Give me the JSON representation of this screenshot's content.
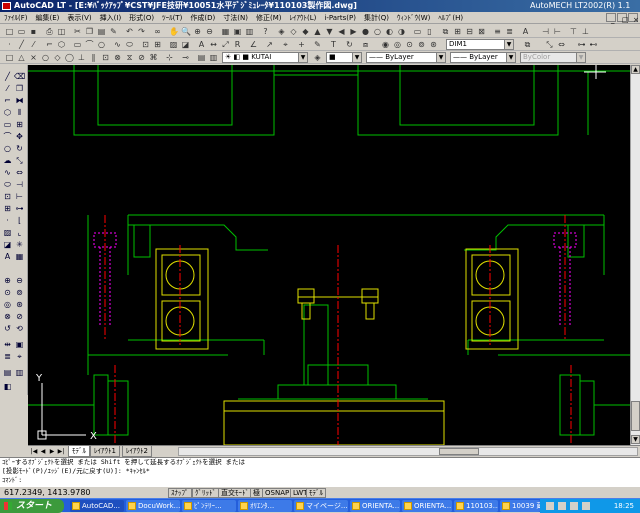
{
  "window": {
    "title": "AutoCAD LT - [E:¥ﾊﾞｯｸｱｯﾌﾟ¥CST¥JFE技研¥10051水平ﾃﾞｼﾞﾐｭﾚｰﾀ¥110103製作図.dwg]",
    "secondary_title": "AutoMECH LT2002(R) 1.1"
  },
  "menu": {
    "items": [
      "ﾌｧｲﾙ(F)",
      "編集(E)",
      "表示(V)",
      "挿入(I)",
      "形式(O)",
      "ﾂｰﾙ(T)",
      "作成(D)",
      "寸法(N)",
      "修正(M)",
      "ﾚｲｱｳﾄ(L)",
      "i-Parts(P)",
      "集計(Q)",
      "ｳｨﾝﾄﾞｳ(W)",
      "ﾍﾙﾌﾟ(H)"
    ]
  },
  "toolbar": {
    "dimstyle": "DIM1",
    "layer": "KUTAI",
    "color": "ByLayer",
    "linetype": "ByLayer",
    "lineweight": "ByLayer",
    "plotstyle": "ByColor"
  },
  "tabs": [
    "ﾓﾃﾞﾙ",
    "ﾚｲｱｳﾄ1",
    "ﾚｲｱｳﾄ2"
  ],
  "command": {
    "line1": "ｺﾋﾟｰするｵﾌﾞｼﾞｪｸﾄを選択 または Shift を押して延長するｵﾌﾞｼﾞｪｸﾄを選択 または",
    "line2": "[投影ﾓｰﾄﾞ(P)/ｴｯｼﾞ(E)/元に戻す(U)]: *ｷｬﾝｾﾙ*",
    "prompt": "ｺﾏﾝﾄﾞ:"
  },
  "status": {
    "coords": "617.2349, 1413.9780",
    "buttons": [
      "ｽﾅｯﾌﾟ",
      "ｸﾞﾘｯﾄﾞ",
      "直交ﾓｰﾄﾞ",
      "極",
      "OSNAP",
      "LWT",
      "ﾓﾃﾞﾙ"
    ]
  },
  "ucs": {
    "x_label": "X",
    "y_label": "Y"
  },
  "taskbar": {
    "start": "スタート",
    "tasks": [
      "AutoCAD...",
      "DocuWork...",
      "ﾋﾟﾝﾃﾘｰ...",
      "ｵﾘｴﾝﾀ...",
      "マイページ...",
      "ORIENTA...",
      "ORIENTA...",
      "110103...",
      "10039 蔵..."
    ],
    "clock": "18:25"
  },
  "colors": {
    "canvas": "#000000",
    "green": "#00c000",
    "yellow": "#e0e000",
    "magenta": "#ff00ff",
    "red": "#ff0000",
    "titlebar": "#0a246a",
    "taskbar": "#245edb"
  }
}
